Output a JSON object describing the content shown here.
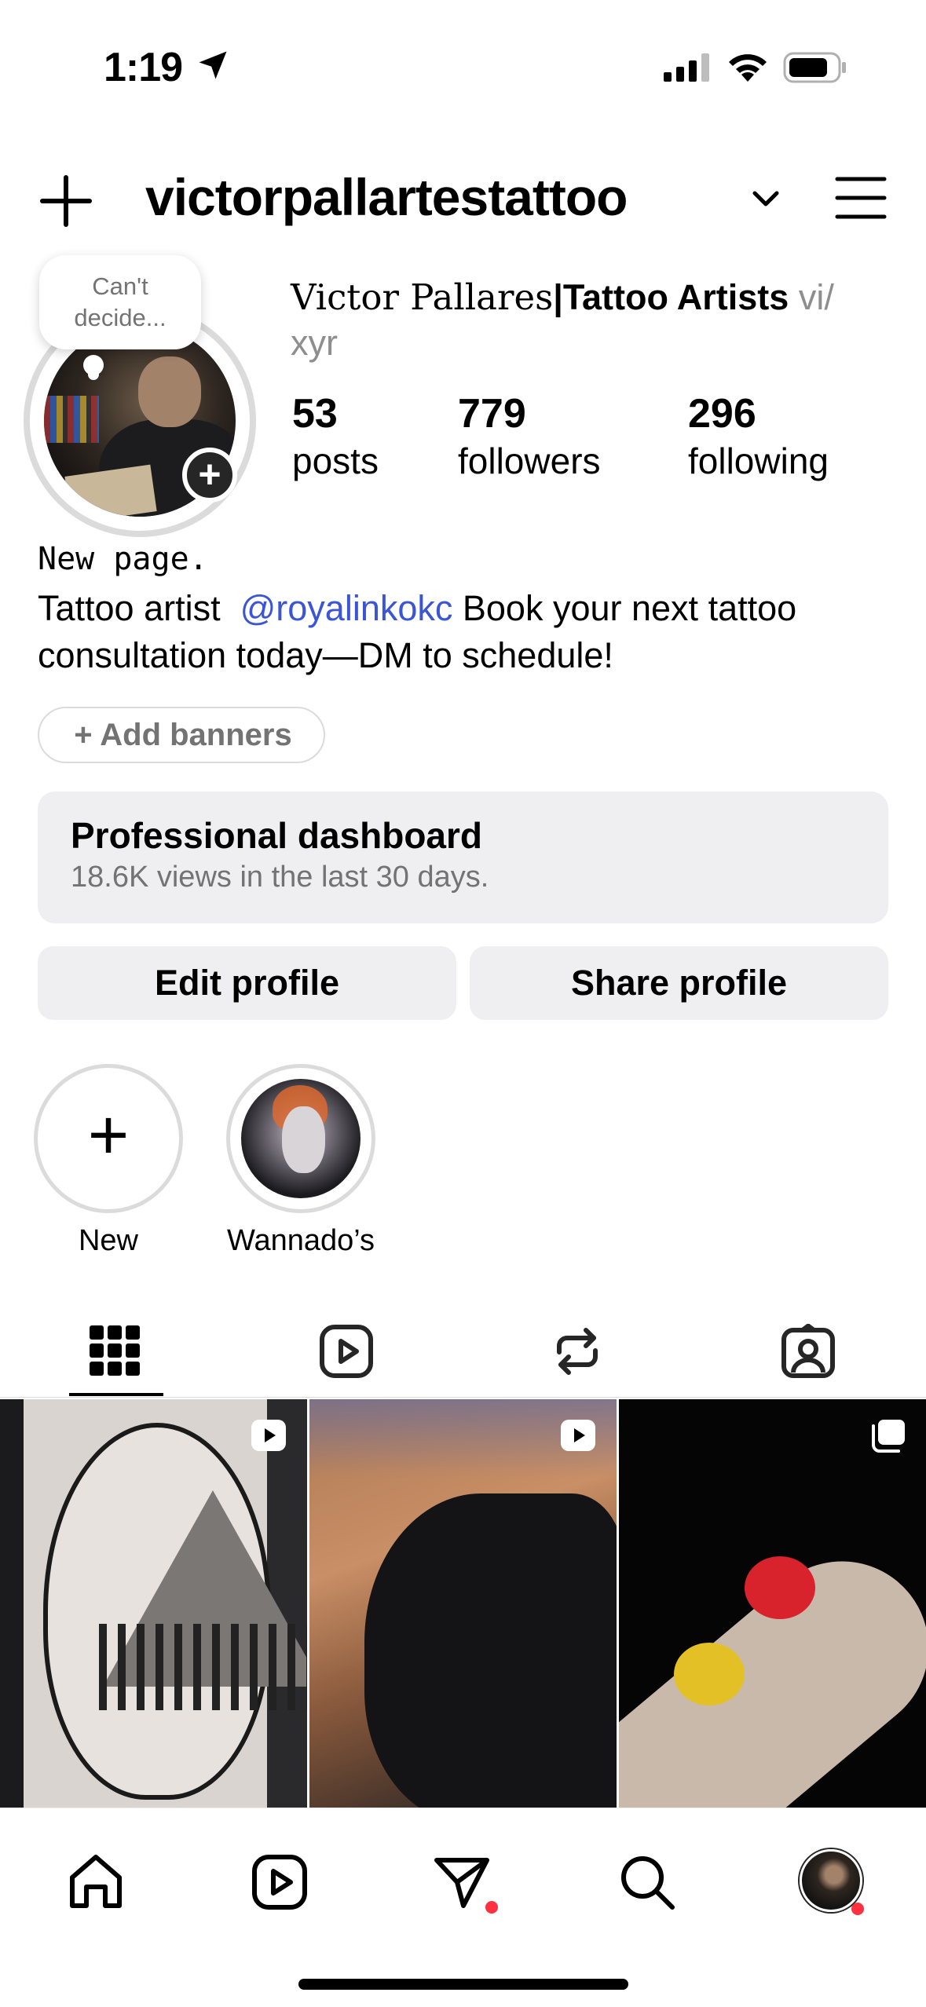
{
  "status_bar": {
    "time": "1:19"
  },
  "header": {
    "username": "victorpallartestattoo"
  },
  "profile": {
    "note_line1": "Can't",
    "note_line2": "decide...",
    "display_name_serif": "Victor Pallares",
    "display_name_bold": "|Tattoo Artists",
    "pronouns_part1": " vi/",
    "pronouns_part2": "xyr",
    "stats": {
      "posts_count": "53",
      "posts_label": "posts",
      "followers_count": "779",
      "followers_label": "followers",
      "following_count": "296",
      "following_label": "following"
    },
    "bio_line1": "New page.",
    "bio_prefix": "Tattoo artist  ",
    "bio_mention": "@royalinkokc",
    "bio_suffix": " Book your next tattoo consultation today—DM to schedule!",
    "add_banners_label": "+ Add banners"
  },
  "dashboard": {
    "title": "Professional dashboard",
    "subtitle": "18.6K views in the last 30 days."
  },
  "actions": {
    "edit_label": "Edit profile",
    "share_label": "Share profile"
  },
  "highlights": [
    {
      "label": "New"
    },
    {
      "label": "Wannado’s"
    }
  ],
  "tabs": [
    {
      "icon": "grid-icon",
      "active": true
    },
    {
      "icon": "reels-icon"
    },
    {
      "icon": "reposts-icon"
    },
    {
      "icon": "tagged-icon"
    }
  ],
  "posts": [
    {
      "type": "reel",
      "icon": "reel-icon"
    },
    {
      "type": "reel",
      "icon": "reel-icon"
    },
    {
      "type": "carousel",
      "icon": "carousel-icon"
    }
  ],
  "bottom_nav": [
    "home-icon",
    "reels-icon",
    "messages-icon",
    "search-icon",
    "profile-avatar"
  ],
  "colors": {
    "mention": "#3b55d6",
    "notification": "#ff3040",
    "button_bg": "#efeff1"
  }
}
